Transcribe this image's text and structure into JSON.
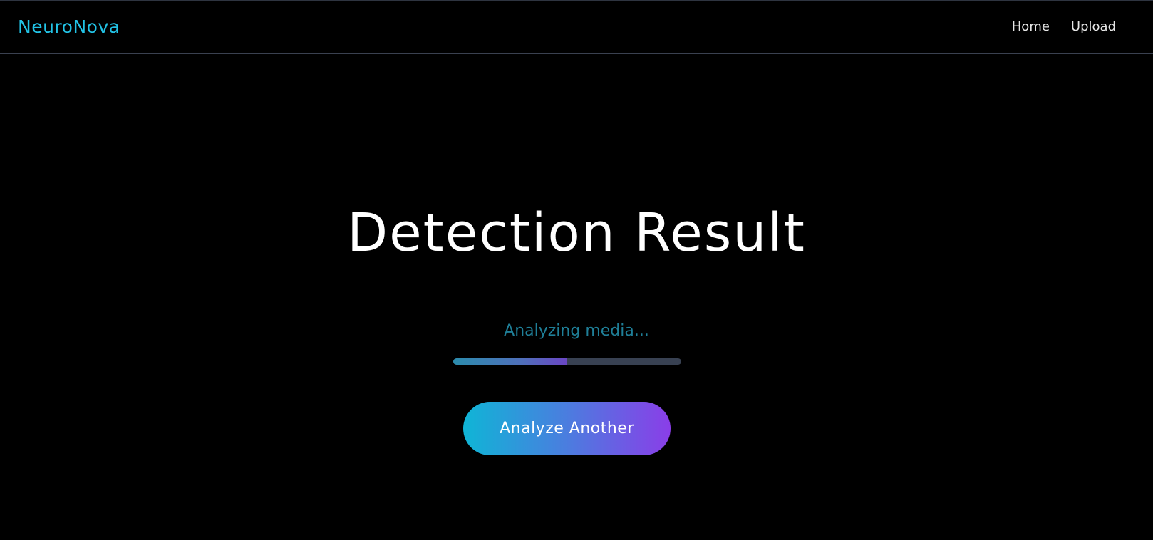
{
  "header": {
    "brand": "NeuroNova",
    "nav": [
      {
        "label": "Home"
      },
      {
        "label": "Upload"
      }
    ]
  },
  "main": {
    "title": "Detection Result",
    "status_text": "Analyzing media...",
    "progress_percent": 50,
    "analyze_button_label": "Analyze Another"
  },
  "colors": {
    "background": "#000000",
    "brand": "#22c3e6",
    "status_text": "#1f7f98",
    "progress_track": "#384152",
    "button_gradient_start": "#0fb5d6",
    "button_gradient_end": "#8a3ee8"
  }
}
